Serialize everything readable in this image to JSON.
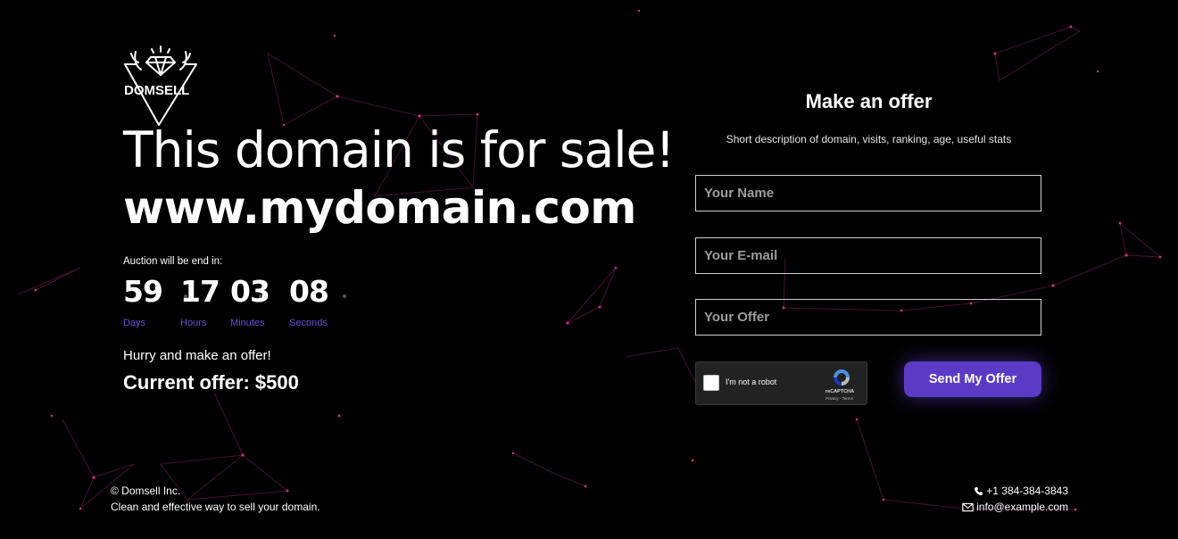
{
  "brand": {
    "name": "DOMSELL"
  },
  "hero": {
    "headline": "This domain is for sale!",
    "domain": "www.mydomain.com"
  },
  "auction": {
    "label": "Auction will be end in:",
    "days": "59",
    "hours": "17",
    "minutes": "03",
    "seconds": "08",
    "days_label": "Days",
    "hours_label": "Hours",
    "minutes_label": "Minutes",
    "seconds_label": "Seconds"
  },
  "offer": {
    "hurry": "Hurry and make an offer!",
    "current": "Current offer: $500"
  },
  "form": {
    "title": "Make an offer",
    "description": "Short description of domain, visits, ranking, age, useful stats",
    "name_placeholder": "Your Name",
    "email_placeholder": "Your E-mail",
    "offer_placeholder": "Your Offer",
    "submit_label": "Send My Offer"
  },
  "recaptcha": {
    "checkbox_label": "I'm not a robot",
    "brand": "reCAPTCHA",
    "terms": "Privacy - Terms"
  },
  "footer": {
    "copyright": "© Domsell Inc.",
    "tagline": "Clean and effective way to sell your domain.",
    "phone": "+1 384-384-3843",
    "email": "info@example.com"
  },
  "colors": {
    "background": "#000000",
    "accent": "#5b3bc6",
    "countdown_label": "#6a4fd8",
    "network_lines": "#6e1f55"
  },
  "icons": {
    "logo": "diamond-antlers-logo",
    "phone": "phone-icon",
    "email": "envelope-icon",
    "recaptcha": "recaptcha-icon"
  }
}
